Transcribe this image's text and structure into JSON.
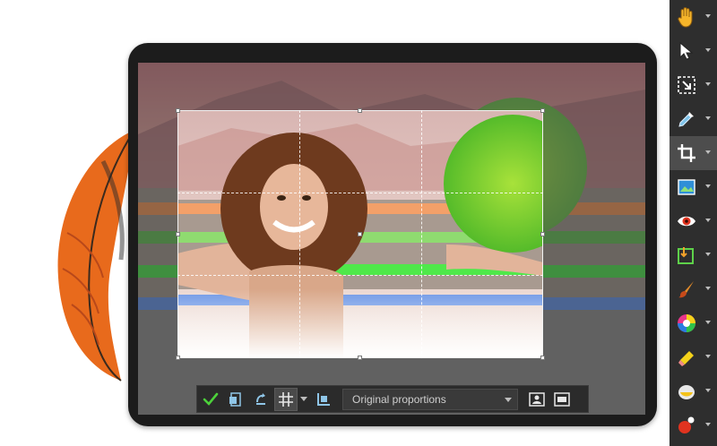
{
  "crop_toolbar": {
    "apply_label": "Apply crop",
    "aspect_value": "Original proportions"
  },
  "tool_palette": {
    "tools": [
      {
        "name": "pan-tool",
        "icon": "hand-icon"
      },
      {
        "name": "pick-tool",
        "icon": "arrow-icon"
      },
      {
        "name": "select-tool",
        "icon": "selection-icon"
      },
      {
        "name": "dropper-tool",
        "icon": "eyedropper-icon"
      },
      {
        "name": "crop-tool",
        "icon": "crop-icon",
        "active": true
      },
      {
        "name": "straighten-tool",
        "icon": "image-icon"
      },
      {
        "name": "red-eye-tool",
        "icon": "eye-icon"
      },
      {
        "name": "clone-tool",
        "icon": "clone-icon"
      },
      {
        "name": "paint-tool",
        "icon": "brush-icon"
      },
      {
        "name": "color-tool",
        "icon": "color-wheel-icon"
      },
      {
        "name": "eraser-tool",
        "icon": "eraser-icon"
      },
      {
        "name": "fill-tool",
        "icon": "bucket-icon"
      },
      {
        "name": "picture-tube-tool",
        "icon": "tube-icon"
      }
    ]
  },
  "colors": {
    "accent_green": "#46c23a",
    "palette_bg": "#2e2e2e",
    "toolbar_bg": "#2b2b2b"
  }
}
